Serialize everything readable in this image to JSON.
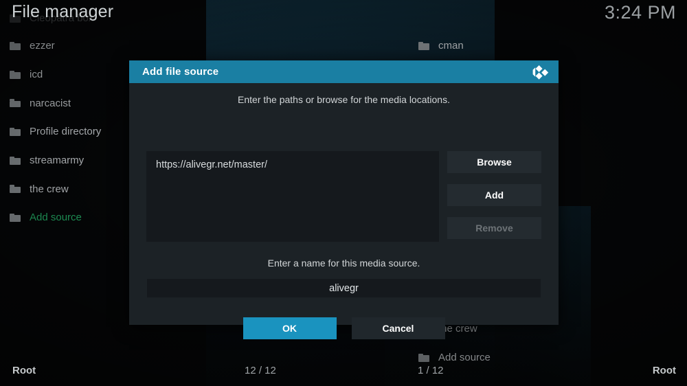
{
  "header": {
    "title": "File manager",
    "clock": "3:24 PM"
  },
  "left_panel": {
    "ghost_item": {
      "label": "Cleopatra box",
      "icon": "folder-icon"
    },
    "items": [
      {
        "label": "ezzer",
        "icon": "folder-icon",
        "accent": false
      },
      {
        "label": "icd",
        "icon": "folder-icon",
        "accent": false
      },
      {
        "label": "narcacist",
        "icon": "folder-icon",
        "accent": false
      },
      {
        "label": "Profile directory",
        "icon": "folder-icon",
        "accent": false
      },
      {
        "label": "streamarmy",
        "icon": "folder-icon",
        "accent": false
      },
      {
        "label": "the crew",
        "icon": "folder-icon",
        "accent": false
      },
      {
        "label": "Add source",
        "icon": "folder-icon",
        "accent": true
      }
    ]
  },
  "right_panel": {
    "items": [
      {
        "label": "cman",
        "icon": "folder-icon",
        "accent": false
      },
      {
        "label": "the crew",
        "icon": "folder-icon",
        "accent": false
      },
      {
        "label": "Add source",
        "icon": "folder-icon",
        "accent": false
      }
    ]
  },
  "footer": {
    "left_location": "Root",
    "left_count": "12 / 12",
    "right_count": "1 / 12",
    "right_location": "Root"
  },
  "dialog": {
    "title": "Add file source",
    "logo_icon": "kodi-logo-icon",
    "paths_hint": "Enter the paths or browse for the media locations.",
    "path_value": "https://alivegr.net/master/",
    "buttons": {
      "browse": "Browse",
      "add": "Add",
      "remove": "Remove"
    },
    "name_hint": "Enter a name for this media source.",
    "name_value": "alivegr",
    "ok": "OK",
    "cancel": "Cancel"
  },
  "colors": {
    "accent_blue": "#1a7fa3",
    "primary_button": "#1a93bf",
    "green_accent": "#21a05e",
    "dialog_bg": "#1c2226",
    "field_bg": "#15191d"
  }
}
